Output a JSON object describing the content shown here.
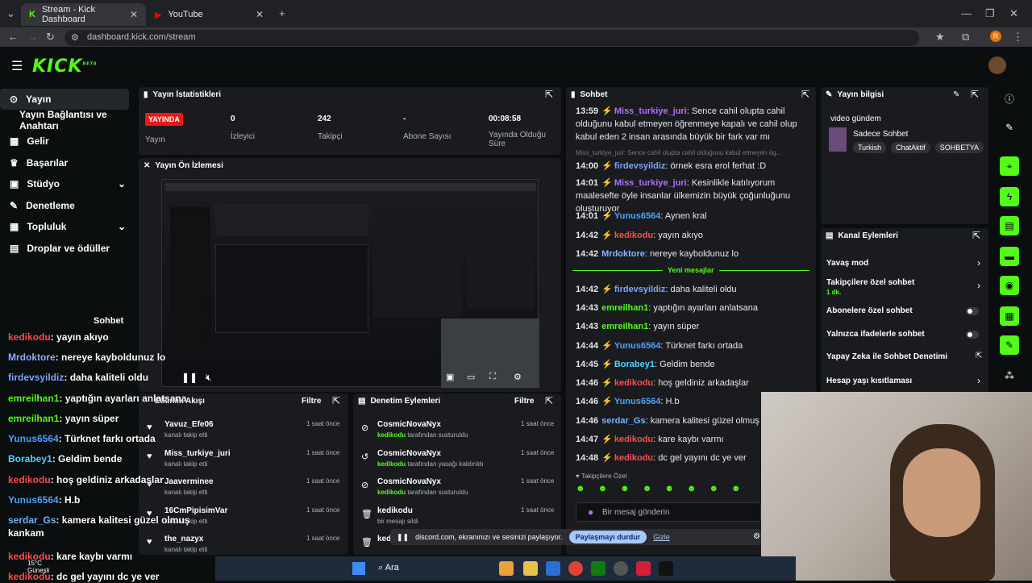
{
  "browser": {
    "tabs": [
      {
        "label": "Stream - Kick Dashboard"
      },
      {
        "label": "YouTube"
      }
    ],
    "url": "dashboard.kick.com/stream"
  },
  "logo": "KICK",
  "logo_badge": "BETA",
  "sidebar": {
    "items": [
      {
        "label": "Yayın"
      },
      {
        "label": "Yayın Bağlantısı ve Anahtarı"
      },
      {
        "label": "Gelir"
      },
      {
        "label": "Başarılar"
      },
      {
        "label": "Stüdyo"
      },
      {
        "label": "Denetleme"
      },
      {
        "label": "Topluluk"
      },
      {
        "label": "Droplar ve ödüller"
      }
    ]
  },
  "stats": {
    "title": "Yayın İstatistikleri",
    "status_badge": "YAYINDA",
    "status_label": "Yayın",
    "viewers_value": "0",
    "viewers_label": "İzleyici",
    "followers_value": "242",
    "followers_label": "Takipçi",
    "subs_value": "-",
    "subs_label": "Abone Sayısı",
    "duration_value": "00:08:58",
    "duration_label": "Yayında Olduğu Süre"
  },
  "preview": {
    "title": "Yayın Ön İzlemesi"
  },
  "activity": {
    "title": "Etkinlik Akışı",
    "filter": "Filtre",
    "items": [
      {
        "name": "Yavuz_Efe06",
        "sub": "kanalı takip etti",
        "time": "1 saat önce"
      },
      {
        "name": "Miss_turkiye_juri",
        "sub": "kanalı takip etti",
        "time": "1 saat önce"
      },
      {
        "name": "Jaaverminee",
        "sub": "kanalı takip etti",
        "time": "1 saat önce"
      },
      {
        "name": "16CmPipisimVar",
        "sub": "kanalı takip etti",
        "time": "1 saat önce"
      },
      {
        "name": "the_nazyx",
        "sub": "kanalı takip etti",
        "time": "1 saat önce"
      }
    ]
  },
  "moderation": {
    "title": "Denetim Eylemleri",
    "filter": "Filtre",
    "items": [
      {
        "name": "CosmicNovaNyx",
        "actor": "kedikodu",
        "sub": "tarafından susturuldu",
        "time": "1 saat önce"
      },
      {
        "name": "CosmicNovaNyx",
        "actor": "kedikodu",
        "sub": "tarafından yasağı kaldırıldı",
        "time": "1 saat önce"
      },
      {
        "name": "CosmicNovaNyx",
        "actor": "kedikodu",
        "sub": "tarafından susturuldu",
        "time": "1 saat önce"
      },
      {
        "name": "kedikodu",
        "actor": "",
        "sub": "bir mesajı sildi",
        "time": "1 saat önce"
      },
      {
        "name": "ked",
        "actor": "",
        "sub": "",
        "time": ""
      }
    ]
  },
  "chat": {
    "title": "Sohbet",
    "lines": [
      {
        "time": "13:59",
        "user": "Miss_turkiye_juri",
        "color": "#b56dff",
        "msg": "Sence cahil olupta cahil olduğunu kabul etmeyen öğrenmeye kapalı ve cahil olup kabul eden 2 insan arasında büyük bir fark var mı"
      },
      {
        "time": "",
        "user": "",
        "color": "#777",
        "msg": "Miss_turkiye_juri: Sence cahil olupta cahil olduğunu kabul etmeyen ög..."
      },
      {
        "time": "14:00",
        "user": "firdevsyildiz",
        "color": "#7aa7ff",
        "msg": "örnek esra erol ferhat :D"
      },
      {
        "time": "14:01",
        "user": "Miss_turkiye_juri",
        "color": "#b56dff",
        "msg": "Kesinlikle katılıyorum maalesefte öyle insanlar ülkemizin büyük çoğunluğunu oluşturuyor"
      },
      {
        "time": "14:01",
        "user": "Yunus6564",
        "color": "#4da3ff",
        "msg": "Aynen kral"
      },
      {
        "time": "14:42",
        "user": "kedikodu",
        "color": "#ff4d4d",
        "msg": "yayın akıyo"
      },
      {
        "time": "14:42",
        "user": "Mrdoktore",
        "color": "#8fb0ff",
        "msg": "nereye kayboldunuz lo"
      },
      {
        "time": "14:42",
        "user": "firdevsyildiz",
        "color": "#7aa7ff",
        "msg": "daha kaliteli oldu"
      },
      {
        "time": "14:43",
        "user": "emreilhan1",
        "color": "#53fc18",
        "msg": "yaptığın ayarları anlatsana"
      },
      {
        "time": "14:43",
        "user": "emreilhan1",
        "color": "#53fc18",
        "msg": "yayın süper"
      },
      {
        "time": "14:44",
        "user": "Yunus6564",
        "color": "#4da3ff",
        "msg": "Türknet farkı ortada"
      },
      {
        "time": "14:45",
        "user": "Borabey1",
        "color": "#4dd4ff",
        "msg": "Geldim bende"
      },
      {
        "time": "14:46",
        "user": "kedikodu",
        "color": "#ff4d4d",
        "msg": "hoş geldiniz arkadaşlar"
      },
      {
        "time": "14:46",
        "user": "Yunus6564",
        "color": "#4da3ff",
        "msg": "H.b"
      },
      {
        "time": "14:46",
        "user": "serdar_Gs",
        "color": "#6fb7ff",
        "msg": "kamera kalitesi güzel olmuş k"
      },
      {
        "time": "14:47",
        "user": "kedikodu",
        "color": "#ff4d4d",
        "msg": "kare kaybı varmı"
      },
      {
        "time": "14:48",
        "user": "kedikodu",
        "color": "#ff4d4d",
        "msg": "dc gel yayını dc ye ver"
      }
    ],
    "new_messages": "Yeni mesajlar",
    "followers_only": "Takipçilere Özel",
    "input_placeholder": "Bir mesaj gönderin"
  },
  "stream_info": {
    "title": "Yayın bilgisi",
    "stream_title": "video gündem",
    "category": "Sadece Sohbet",
    "tags": [
      "Turkish",
      "ChatAktif",
      "SOHBETYA"
    ]
  },
  "channel_actions": {
    "title": "Kanal Eylemleri",
    "items": [
      {
        "label": "Yavaş mod",
        "sub": ""
      },
      {
        "label": "Takipçilere özel sohbet",
        "sub": "1 dk."
      },
      {
        "label": "Abonelere özel sohbet",
        "sub": ""
      },
      {
        "label": "Yalnızca ifadelerle sohbet",
        "sub": ""
      },
      {
        "label": "Yapay Zeka ile Sohbet Denetimi",
        "sub": ""
      },
      {
        "label": "Hesap yaşı kısıtlaması",
        "sub": ""
      }
    ]
  },
  "overlay_chat": {
    "title": "Sohbet",
    "lines": [
      {
        "user": "kedikodu",
        "color": "#ff4d4d",
        "msg": ": yayın akıyo"
      },
      {
        "user": "Mrdoktore",
        "color": "#8fb0ff",
        "msg": ": nereye kayboldunuz lo"
      },
      {
        "user": "firdevsyildiz",
        "color": "#7aa7ff",
        "msg": ": daha kaliteli oldu"
      },
      {
        "user": "emreilhan1",
        "color": "#53fc18",
        "msg": ": yaptığın ayarları anlatsana"
      },
      {
        "user": "emreilhan1",
        "color": "#53fc18",
        "msg": ": yayın süper"
      },
      {
        "user": "Yunus6564",
        "color": "#4da3ff",
        "msg": ": Türknet farkı ortada"
      },
      {
        "user": "Borabey1",
        "color": "#4dd4ff",
        "msg": ": Geldim bende"
      },
      {
        "user": "kedikodu",
        "color": "#ff4d4d",
        "msg": ": hoş geldiniz arkadaşlar"
      },
      {
        "user": "Yunus6564",
        "color": "#4da3ff",
        "msg": ": H.b"
      },
      {
        "user": "serdar_Gs",
        "color": "#6fb7ff",
        "msg": ": kamera kalitesi güzel olmuş kankam"
      },
      {
        "user": "kedikodu",
        "color": "#ff4d4d",
        "msg": ": kare kaybı varmı"
      },
      {
        "user": "kedikodu",
        "color": "#ff4d4d",
        "msg": ": dc gel yayını dc ye ver"
      }
    ]
  },
  "share_bar": {
    "text": "discord.com, ekranınızı ve sesinizi paylaşıyor.",
    "stop": "Paylaşmayı durdur",
    "hide": "Gizle"
  },
  "taskbar": {
    "search": "Ara",
    "weather": "15°C",
    "weather_sub": "Güneşli"
  }
}
